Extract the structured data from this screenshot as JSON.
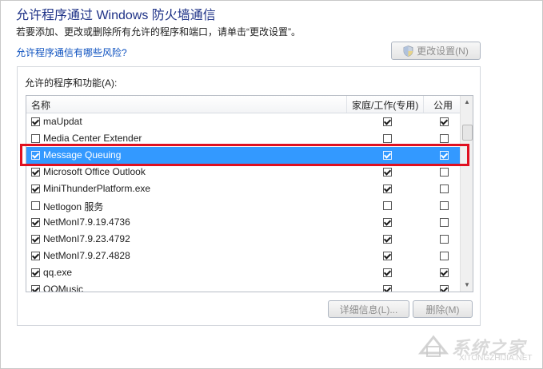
{
  "header": {
    "title": "允许程序通过 Windows 防火墙通信",
    "subtitle": "若要添加、更改或删除所有允许的程序和端口，请单击“更改设置”。",
    "risk_link": "允许程序通信有哪些风险?",
    "change_settings_label": "更改设置(N)"
  },
  "group": {
    "label": "允许的程序和功能(A):"
  },
  "table": {
    "columns": [
      "名称",
      "家庭/工作(专用)",
      "公用"
    ],
    "rows": [
      {
        "name": "maUpdat",
        "enabled": true,
        "home": true,
        "public": true
      },
      {
        "name": "Media Center Extender",
        "enabled": false,
        "home": false,
        "public": false
      },
      {
        "name": "Message Queuing",
        "enabled": true,
        "home": true,
        "public": true,
        "selected": true
      },
      {
        "name": "Microsoft Office Outlook",
        "enabled": true,
        "home": true,
        "public": false
      },
      {
        "name": "MiniThunderPlatform.exe",
        "enabled": true,
        "home": true,
        "public": false
      },
      {
        "name": "Netlogon 服务",
        "enabled": false,
        "home": false,
        "public": false
      },
      {
        "name": "NetMonI7.9.19.4736",
        "enabled": true,
        "home": true,
        "public": false
      },
      {
        "name": "NetMonI7.9.23.4792",
        "enabled": true,
        "home": true,
        "public": false
      },
      {
        "name": "NetMonI7.9.27.4828",
        "enabled": true,
        "home": true,
        "public": false
      },
      {
        "name": "qq.exe",
        "enabled": true,
        "home": true,
        "public": true
      },
      {
        "name": "QQMusic",
        "enabled": true,
        "home": true,
        "public": true
      }
    ]
  },
  "buttons": {
    "details_label": "详细信息(L)...",
    "delete_label": "删除(M)"
  },
  "watermark": {
    "text": "系统之家",
    "url": "XITONGZHIJIA.NET"
  },
  "colors": {
    "selection": "#3399ff",
    "highlight_box": "#e01020",
    "title": "#1e3287",
    "link": "#0a4fbf"
  }
}
